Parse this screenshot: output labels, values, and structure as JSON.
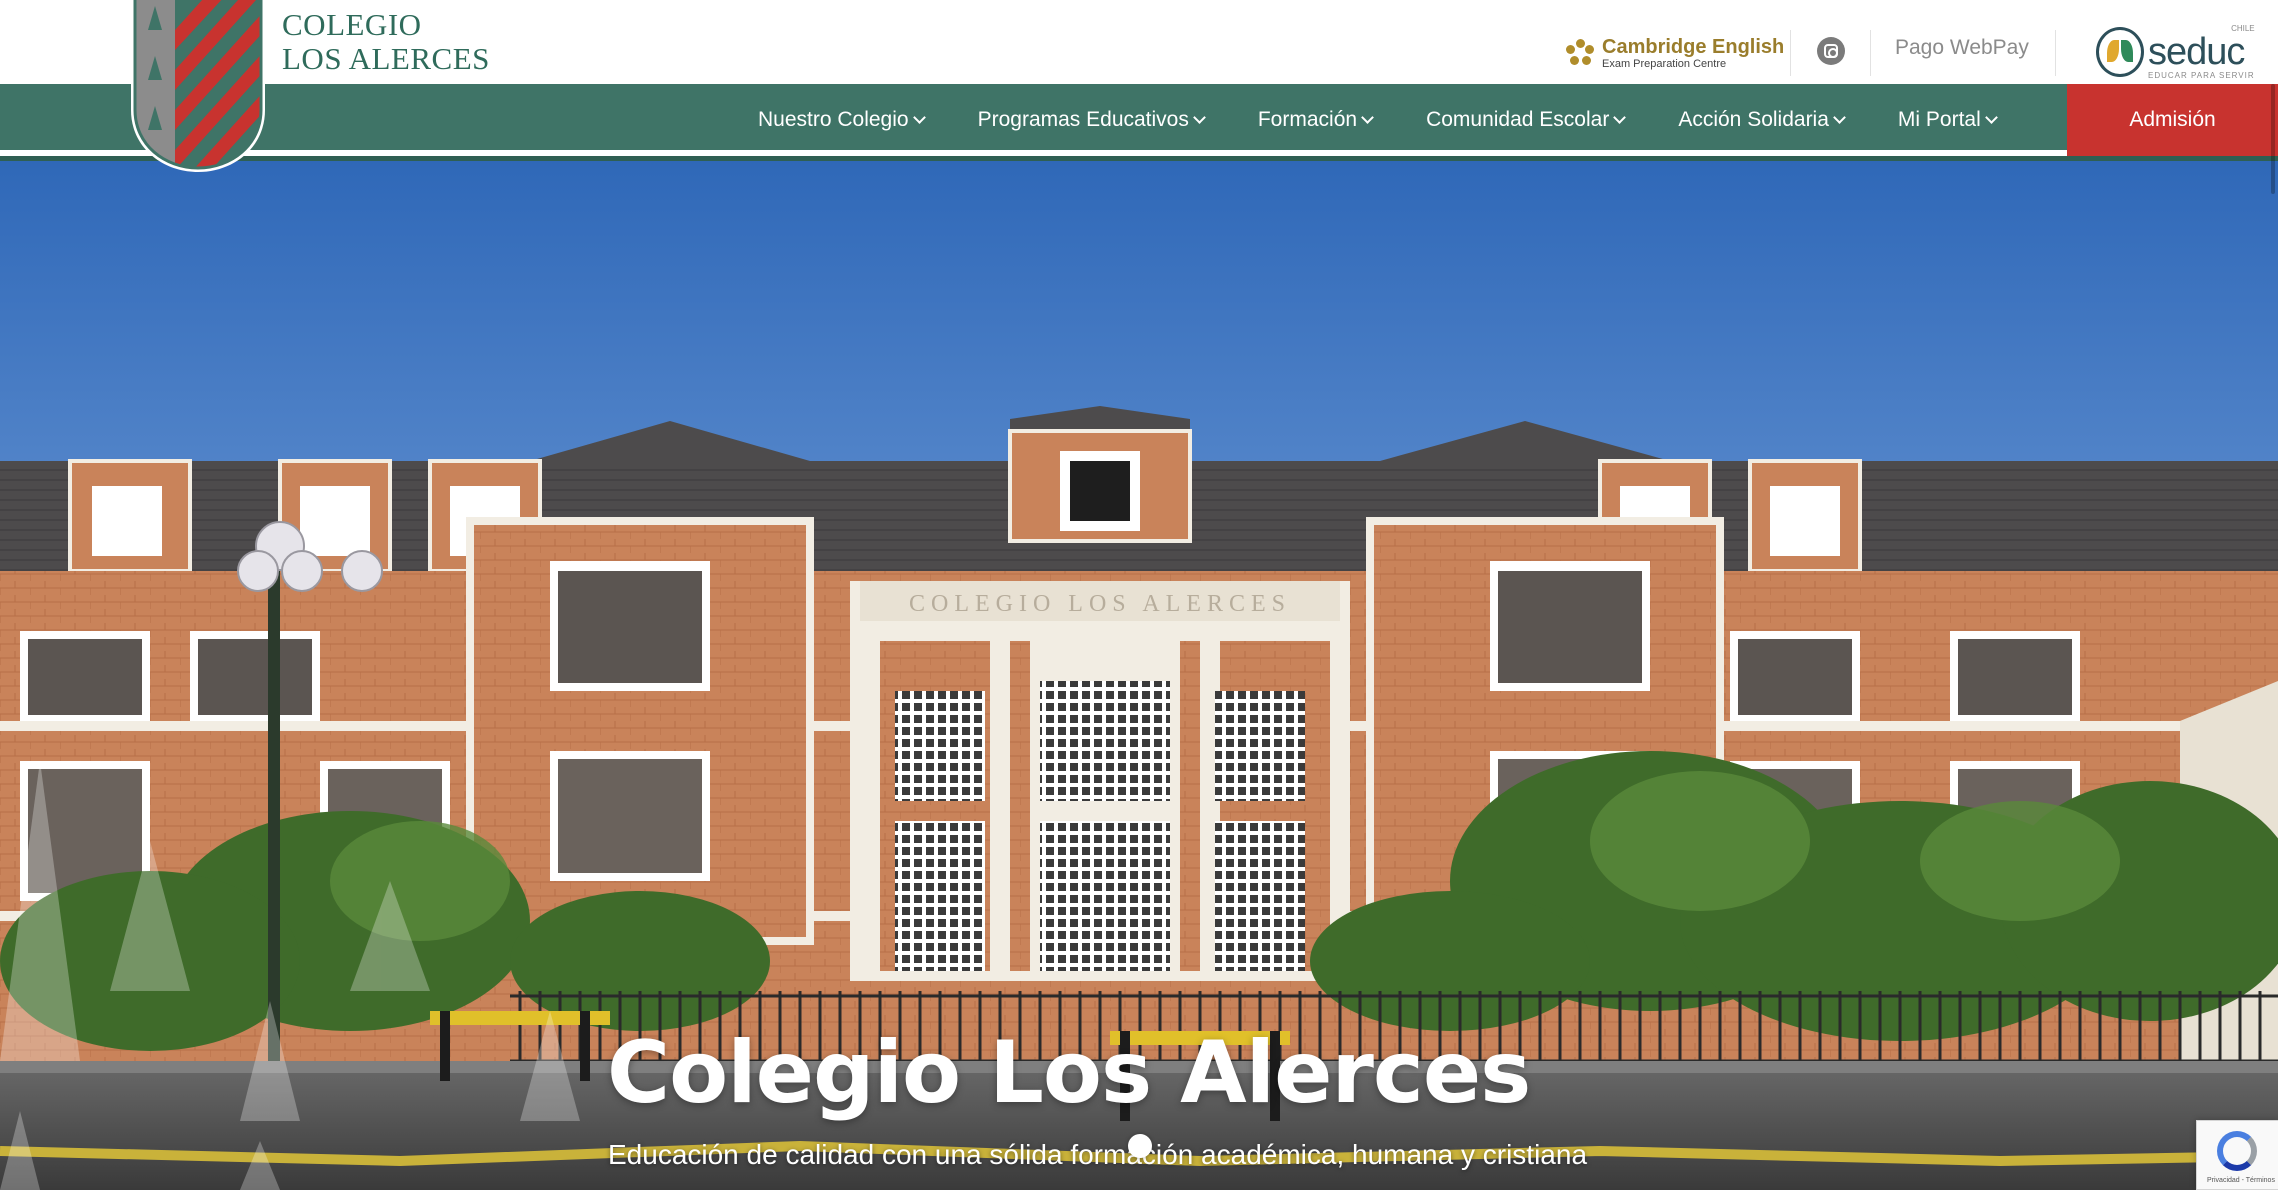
{
  "header": {
    "brand_line1": "COLEGIO",
    "brand_line2": "LOS ALERCES",
    "cambridge_title": "Cambridge English",
    "cambridge_subtitle": "Exam Preparation Centre",
    "webpay_label": "Pago WebPay",
    "seduc_top": "CHILE",
    "seduc_word": "seduc",
    "seduc_tagline": "EDUCAR PARA SERVIR"
  },
  "nav": {
    "items": [
      {
        "label": "Nuestro Colegio"
      },
      {
        "label": "Programas Educativos"
      },
      {
        "label": "Formación"
      },
      {
        "label": "Comunidad Escolar"
      },
      {
        "label": "Acción Solidaria"
      },
      {
        "label": "Mi Portal"
      }
    ],
    "cta_label": "Admisión"
  },
  "hero": {
    "title": "Colegio Los Alerces",
    "subtitle": "Educación de calidad con una sólida formación académica, humana y cristiana",
    "building_inscription": "COLEGIO LOS ALERCES",
    "active_slide": 1,
    "slide_count": 1
  },
  "recaptcha": {
    "text": "Privacidad - Términos"
  },
  "colors": {
    "brand_green": "#3f7467",
    "admission_red": "#c8332f",
    "crest_red": "#c8332f",
    "crest_green": "#3f7467",
    "crest_gray": "#8a8a8a"
  }
}
